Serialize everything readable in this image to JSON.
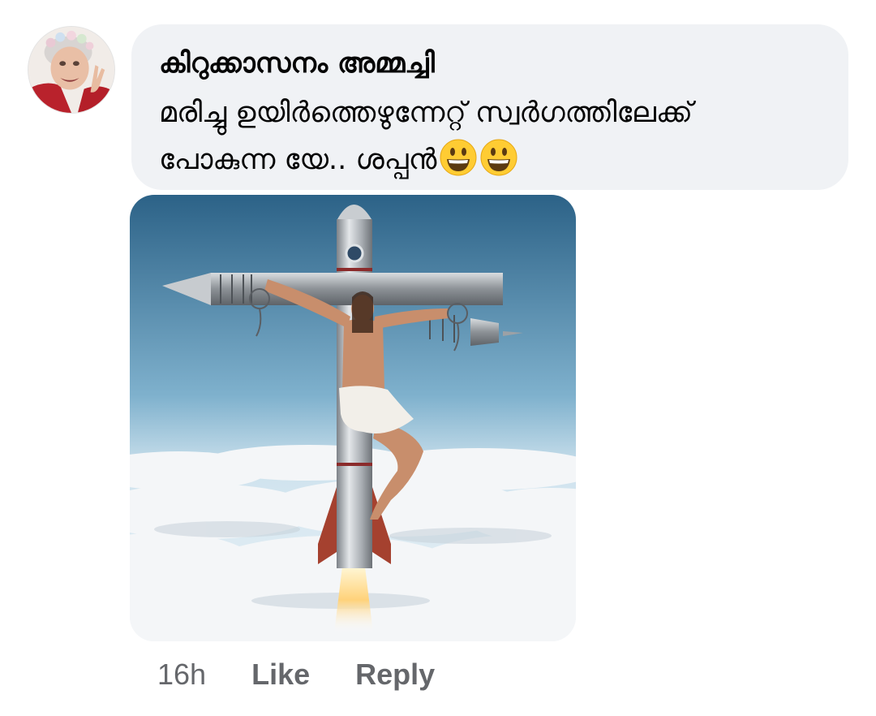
{
  "comment": {
    "author": "കിറുക്കാസനം അമ്മച്ചി",
    "text_lines": [
      "മരിച്ചു ഉയിർത്തെഴുന്നേറ്റ് സ്വർഗത്തിലേക്ക്",
      "പോകുന്ന യേ.. ശപ്പൻ"
    ],
    "emoji": [
      "grinning-face",
      "grinning-face"
    ],
    "avatar_icon": "profile-photo-elderly-woman",
    "attached_image": "ai-art-crucified-figure-on-rocket-cross-above-clouds"
  },
  "actions": {
    "timestamp": "16h",
    "like_label": "Like",
    "reply_label": "Reply"
  },
  "colors": {
    "bubble_background": "#f0f2f5",
    "text_primary": "#050505",
    "text_secondary": "#65676b"
  }
}
